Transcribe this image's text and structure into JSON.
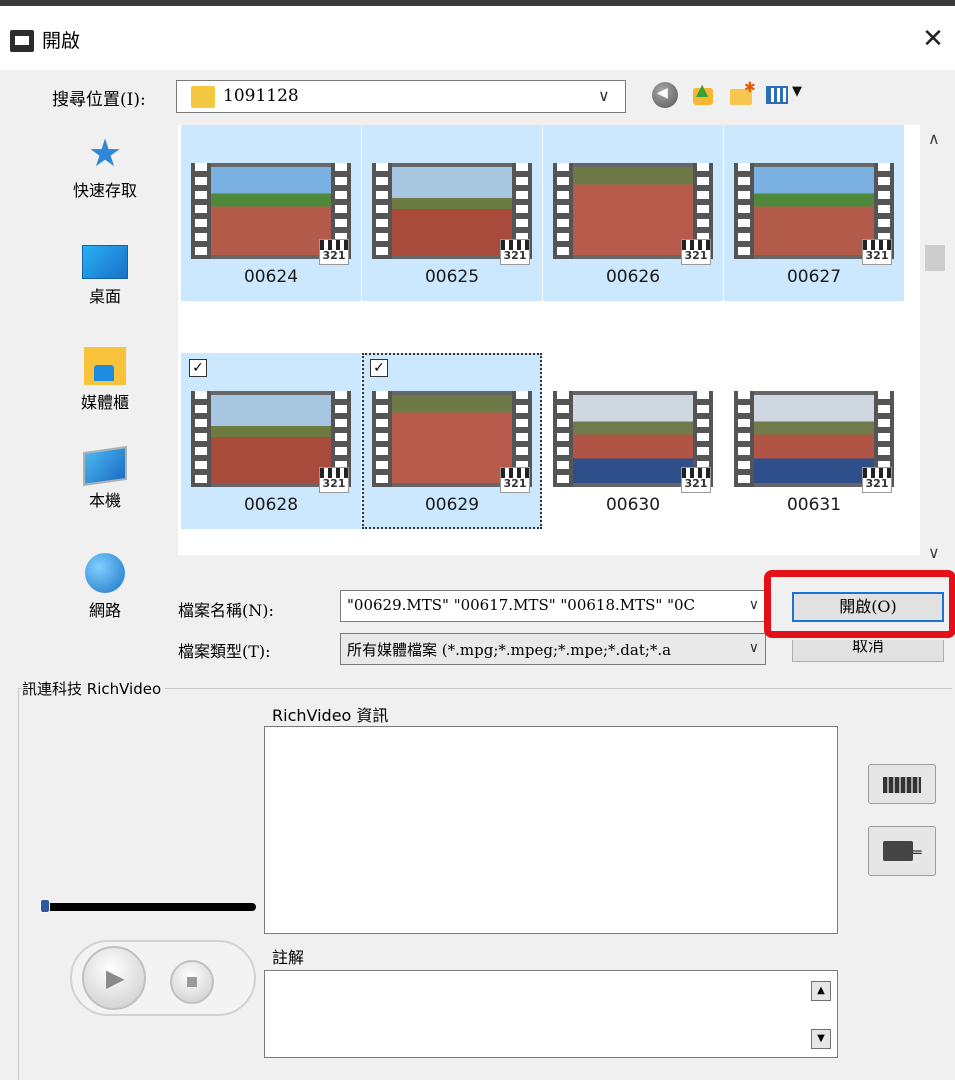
{
  "window": {
    "title": "開啟",
    "close_glyph": "✕"
  },
  "location": {
    "label": "搜尋位置(I):",
    "value": "1091128",
    "dropdown_glyph": "∨"
  },
  "places": [
    {
      "label": "快速存取",
      "icon": "star-icon"
    },
    {
      "label": "桌面",
      "icon": "desktop-icon"
    },
    {
      "label": "媒體櫃",
      "icon": "library-icon"
    },
    {
      "label": "本機",
      "icon": "computer-icon"
    },
    {
      "label": "網路",
      "icon": "network-icon"
    }
  ],
  "files": [
    {
      "name": "00624",
      "selected": true,
      "checked": false
    },
    {
      "name": "00625",
      "selected": true,
      "checked": false
    },
    {
      "name": "00626",
      "selected": true,
      "checked": false
    },
    {
      "name": "00627",
      "selected": true,
      "checked": false
    },
    {
      "name": "00628",
      "selected": true,
      "checked": true
    },
    {
      "name": "00629",
      "selected": true,
      "checked": true,
      "focused": true
    },
    {
      "name": "00630",
      "selected": false,
      "checked": false
    },
    {
      "name": "00631",
      "selected": false,
      "checked": false
    }
  ],
  "badge_text": "321",
  "filename": {
    "label": "檔案名稱(N):",
    "value": "\"00629.MTS\" \"00617.MTS\" \"00618.MTS\" \"0C"
  },
  "filetype": {
    "label": "檔案類型(T):",
    "value": "所有媒體檔案 (*.mpg;*.mpeg;*.mpe;*.dat;*.a"
  },
  "buttons": {
    "open": "開啟(O)",
    "cancel": "取消"
  },
  "richvideo": {
    "group_title": "訊連科技 RichVideo",
    "info_label": "RichVideo 資訊",
    "note_label": "註解"
  },
  "colors": {
    "selection": "#cce8ff",
    "highlight_box": "#e3101a",
    "default_button_border": "#1a74d4"
  }
}
